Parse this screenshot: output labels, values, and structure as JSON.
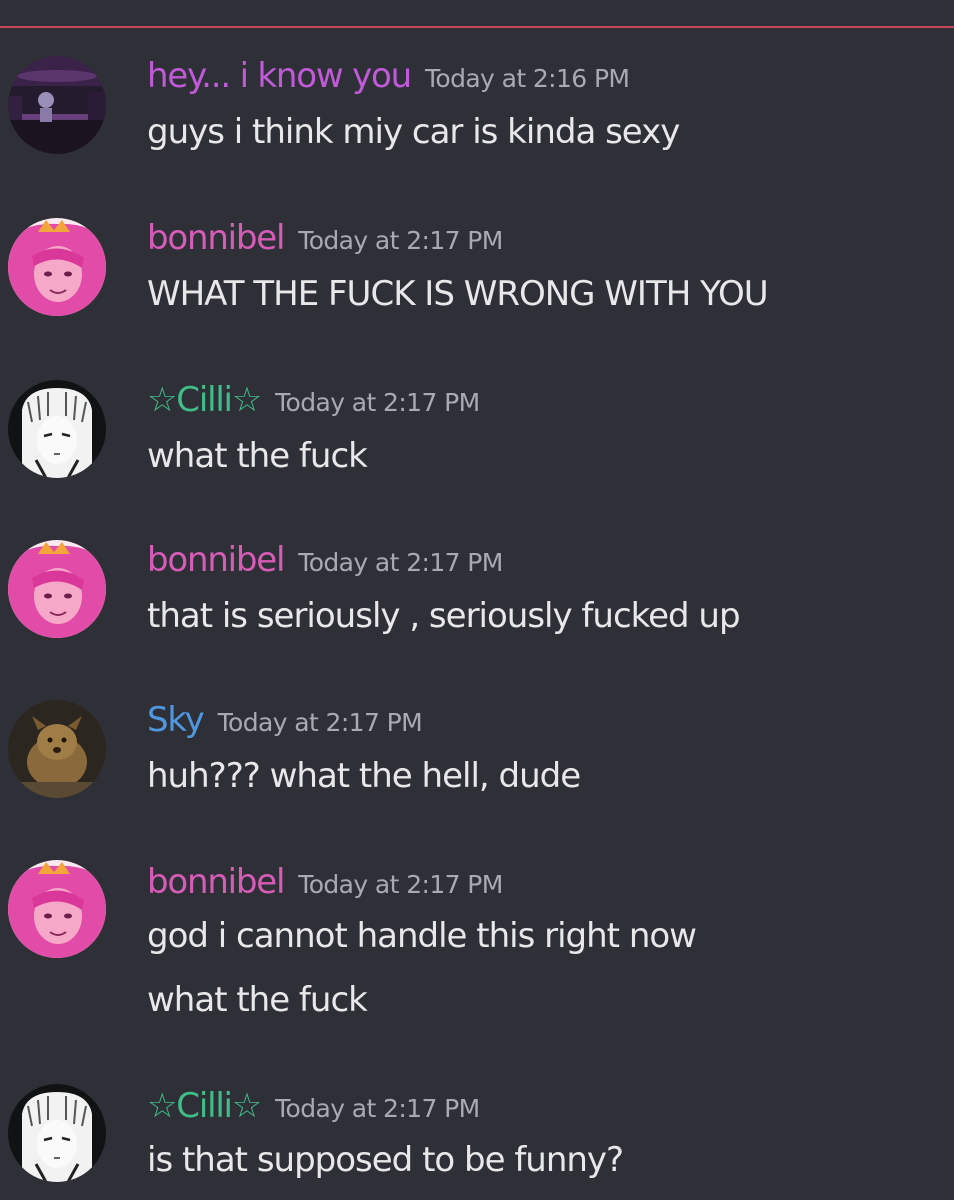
{
  "colors": {
    "background": "#2f3037",
    "divider": "#c2485a",
    "timestamp": "#a9aab1",
    "text": "#e8e8ea"
  },
  "messages": [
    {
      "username": "hey... i know you",
      "username_color": "#c15ad9",
      "avatar_icon": "dark-purple-scene-avatar-icon",
      "timestamp": "Today at 2:16 PM",
      "lines": [
        "guys i think miy car is kinda sexy"
      ]
    },
    {
      "username": "bonnibel",
      "username_color": "#d75cb8",
      "avatar_icon": "pink-hair-princess-avatar-icon",
      "timestamp": "Today at 2:17 PM",
      "lines": [
        "WHAT THE FUCK IS WRONG WITH YOU"
      ]
    },
    {
      "username": "☆Cilli☆",
      "username_color": "#3fbf88",
      "avatar_icon": "white-hair-manga-avatar-icon",
      "timestamp": "Today at 2:17 PM",
      "lines": [
        "what the fuck"
      ]
    },
    {
      "username": "bonnibel",
      "username_color": "#d75cb8",
      "avatar_icon": "pink-hair-princess-avatar-icon",
      "timestamp": "Today at 2:17 PM",
      "lines": [
        "that is seriously , seriously fucked up"
      ]
    },
    {
      "username": "Sky",
      "username_color": "#4f98e0",
      "avatar_icon": "brown-dog-avatar-icon",
      "timestamp": "Today at 2:17 PM",
      "lines": [
        "huh??? what the hell, dude"
      ]
    },
    {
      "username": "bonnibel",
      "username_color": "#d75cb8",
      "avatar_icon": "pink-hair-princess-avatar-icon",
      "timestamp": "Today at 2:17 PM",
      "lines": [
        "god i cannot handle this right now",
        "what the fuck"
      ]
    },
    {
      "username": "☆Cilli☆",
      "username_color": "#3fbf88",
      "avatar_icon": "white-hair-manga-avatar-icon",
      "timestamp": "Today at 2:17 PM",
      "lines": [
        "is that supposed to be funny?"
      ]
    }
  ]
}
